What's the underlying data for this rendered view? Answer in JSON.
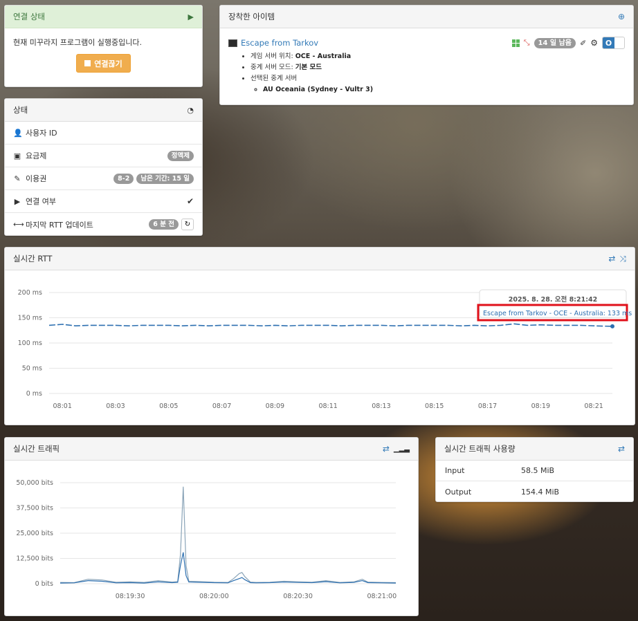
{
  "connection": {
    "title": "연결 상태",
    "message": "현재 미꾸라지 프로그램이 실행중입니다.",
    "disconnect_label": "연결끊기"
  },
  "status": {
    "title": "상태",
    "rows": [
      {
        "icon": "user-icon",
        "label": "사용자 ID",
        "badges": []
      },
      {
        "icon": "money-icon",
        "label": "요금제",
        "badges": [
          "정액제"
        ]
      },
      {
        "icon": "ticket-icon",
        "label": "이용권",
        "badges": [
          "8-2",
          "남은 기간: 15 일"
        ]
      },
      {
        "icon": "play-icon",
        "label": "연결 여부",
        "check": "✔"
      },
      {
        "icon": "arrows-icon",
        "label": "마지막 RTT 업데이트",
        "badges": [
          "6 분 전"
        ]
      }
    ]
  },
  "items": {
    "title": "장착한 아이템",
    "game": {
      "name": "Escape from Tarkov",
      "days_left": "14 일 남음",
      "toggle": "O",
      "server_location_label": "게임 서버 위치: ",
      "server_location": "OCE - Australia",
      "relay_mode_label": "중계 서버 모드: ",
      "relay_mode": "기본 모드",
      "selected_relay_label": "선택된 중계 서버",
      "selected_relay": "AU Oceania (Sydney - Vultr 3)"
    }
  },
  "rtt": {
    "title": "실시간 RTT",
    "tooltip_time": "2025. 8. 28. 오전 8:21:42",
    "tooltip_series": "Escape from Tarkov - OCE - Australia",
    "tooltip_value": "133 ms"
  },
  "traffic": {
    "title": "실시간 트래픽"
  },
  "usage": {
    "title": "실시간 트래픽 사용량",
    "rows": [
      {
        "label": "Input",
        "value": "58.5 MiB"
      },
      {
        "label": "Output",
        "value": "154.4 MiB"
      }
    ]
  },
  "colors": {
    "accent": "#337ab7",
    "warning": "#f0ad4e",
    "success_bg": "#dff0d8",
    "badge": "#999999",
    "highlight": "#e0101a"
  },
  "chart_data": [
    {
      "type": "line",
      "title": "실시간 RTT",
      "yticks": [
        "200 ms",
        "150 ms",
        "100 ms",
        "50 ms",
        "0 ms"
      ],
      "xticks": [
        "08:01",
        "08:03",
        "08:05",
        "08:07",
        "08:09",
        "08:11",
        "08:13",
        "08:15",
        "08:17",
        "08:19",
        "08:21"
      ],
      "ylim": [
        0,
        200
      ],
      "xlim": [
        0.5,
        21.7
      ],
      "series": [
        {
          "name": "Escape from Tarkov - OCE - Australia",
          "x": [
            0.5,
            1.0,
            1.5,
            2.0,
            2.5,
            3.0,
            3.5,
            4.0,
            4.5,
            5.0,
            5.5,
            6.0,
            6.5,
            7.0,
            7.5,
            8.0,
            8.5,
            9.0,
            9.5,
            10.0,
            10.5,
            11.0,
            11.5,
            12.0,
            12.5,
            13.0,
            13.5,
            14.0,
            14.5,
            15.0,
            15.5,
            16.0,
            16.5,
            17.0,
            17.5,
            18.0,
            18.5,
            19.0,
            19.5,
            20.0,
            20.5,
            21.0,
            21.7
          ],
          "y": [
            135,
            137,
            134,
            135,
            135,
            135,
            134,
            135,
            135,
            135,
            134,
            135,
            134,
            135,
            135,
            135,
            134,
            135,
            134,
            135,
            135,
            135,
            134,
            135,
            135,
            135,
            134,
            135,
            135,
            135,
            135,
            134,
            135,
            134,
            135,
            138,
            135,
            136,
            135,
            135,
            135,
            134,
            133
          ]
        }
      ],
      "grid": true
    },
    {
      "type": "line",
      "title": "실시간 트래픽",
      "yticks": [
        "50,000 bits",
        "37,500 bits",
        "25,000 bits",
        "12,500 bits",
        "0 bits"
      ],
      "xticks": [
        "08:19:30",
        "08:20:00",
        "08:20:30",
        "08:21:00"
      ],
      "ylim": [
        0,
        50000
      ],
      "xlim": [
        0,
        120
      ],
      "series": [
        {
          "name": "",
          "x": [
            0,
            5,
            10,
            15,
            20,
            25,
            30,
            35,
            40,
            42,
            43,
            44,
            45,
            46,
            50,
            55,
            60,
            62,
            64,
            65,
            66,
            68,
            70,
            75,
            80,
            85,
            90,
            95,
            100,
            105,
            108,
            110,
            115,
            120
          ],
          "y": [
            600,
            500,
            2200,
            1800,
            700,
            900,
            600,
            1500,
            800,
            1000,
            14500,
            48000,
            9000,
            1200,
            1000,
            700,
            600,
            2500,
            5000,
            5500,
            3500,
            800,
            600,
            700,
            1200,
            900,
            700,
            1500,
            600,
            900,
            2200,
            800,
            600,
            500
          ]
        },
        {
          "name": "",
          "x": [
            0,
            5,
            10,
            15,
            20,
            25,
            30,
            35,
            40,
            42,
            43,
            44,
            45,
            46,
            50,
            55,
            60,
            62,
            64,
            65,
            66,
            68,
            70,
            75,
            80,
            85,
            90,
            95,
            100,
            105,
            108,
            110,
            115,
            120
          ],
          "y": [
            300,
            400,
            1500,
            1200,
            400,
            500,
            300,
            900,
            500,
            700,
            9000,
            15500,
            4000,
            800,
            700,
            500,
            400,
            1500,
            2500,
            3000,
            2000,
            500,
            400,
            500,
            800,
            600,
            500,
            1000,
            400,
            600,
            1500,
            500,
            400,
            300
          ]
        }
      ],
      "grid": true
    }
  ]
}
